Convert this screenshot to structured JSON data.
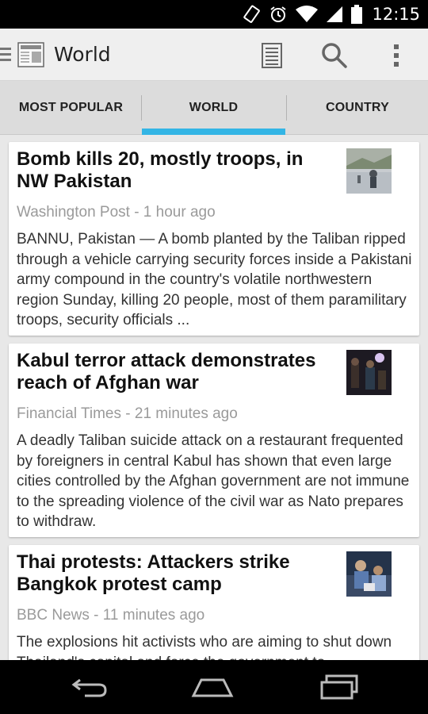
{
  "status_bar": {
    "time": "12:15",
    "icons": [
      "vibrate-icon",
      "alarm-icon",
      "wifi-icon",
      "signal-icon",
      "battery-icon"
    ]
  },
  "action_bar": {
    "title": "World",
    "icons": [
      "drawer-icon",
      "news-logo-icon",
      "read-now-icon",
      "search-icon",
      "overflow-menu-icon"
    ]
  },
  "tabs": [
    {
      "label": "MOST POPULAR",
      "selected": false
    },
    {
      "label": "WORLD",
      "selected": true
    },
    {
      "label": "COUNTRY",
      "selected": false
    }
  ],
  "accent_color": "#33b5e5",
  "articles": [
    {
      "title": "Bomb kills 20, mostly troops, in NW Pakistan",
      "source": "Washington Post - 1 hour ago",
      "snippet": "BANNU, Pakistan — A bomb planted by the Taliban ripped through a vehicle carrying security forces inside a Pakistani army compound in the country's volatile northwestern region Sunday, killing 20 people, most of them paramilitary troops, security officials ..."
    },
    {
      "title": "Kabul terror attack demonstrates reach of Afghan war",
      "source": "Financial Times - 21 minutes ago",
      "snippet": "A deadly Taliban suicide attack on a restaurant frequented by foreigners in central Kabul has shown that even large cities controlled by the Afghan government are not immune to the spreading violence of the civil war as Nato prepares to withdraw."
    },
    {
      "title": "Thai protests: Attackers strike Bangkok protest camp",
      "source": "BBC News - 11 minutes ago",
      "snippet": "The explosions hit activists who are aiming to shut down Thailand's capital and force the government to"
    }
  ],
  "nav_bar": {
    "icons": [
      "back-icon",
      "home-icon",
      "recent-apps-icon"
    ]
  }
}
